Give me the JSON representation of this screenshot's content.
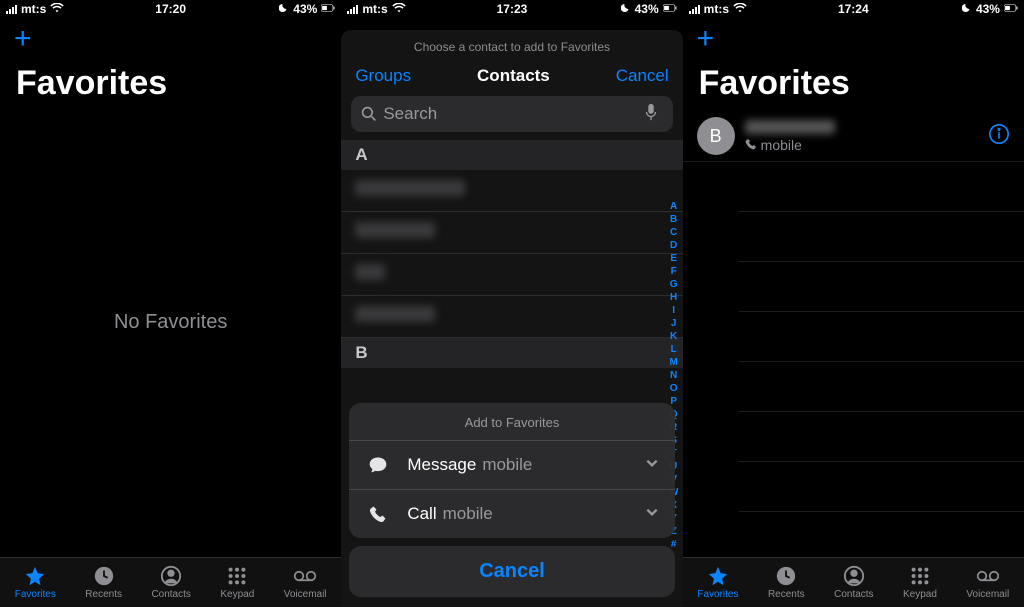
{
  "status": {
    "carrier": "mt:s",
    "battery": "43%",
    "times": [
      "17:20",
      "17:23",
      "17:24"
    ]
  },
  "screen1": {
    "title": "Favorites",
    "empty": "No Favorites"
  },
  "screen2": {
    "hint": "Choose a contact to add to Favorites",
    "groups": "Groups",
    "contacts_title": "Contacts",
    "cancel": "Cancel",
    "search_placeholder": "Search",
    "sections": [
      {
        "letter": "A",
        "rows": [
          110,
          80,
          30,
          80
        ]
      },
      {
        "letter": "B",
        "rows": []
      }
    ],
    "index_letters": [
      "A",
      "B",
      "C",
      "D",
      "E",
      "F",
      "G",
      "H",
      "I",
      "J",
      "K",
      "L",
      "M",
      "N",
      "O",
      "P",
      "Q",
      "R",
      "S",
      "T",
      "U",
      "V",
      "W",
      "X",
      "Y",
      "Z",
      "#"
    ],
    "sheet": {
      "title": "Add to Favorites",
      "rows": [
        {
          "icon": "message",
          "label": "Message",
          "meta": "mobile"
        },
        {
          "icon": "call",
          "label": "Call",
          "meta": "mobile"
        }
      ],
      "cancel": "Cancel"
    }
  },
  "screen3": {
    "title": "Favorites",
    "fav": {
      "initial": "B",
      "sub": "mobile"
    }
  },
  "tabs": {
    "favorites": "Favorites",
    "recents": "Recents",
    "contacts": "Contacts",
    "keypad": "Keypad",
    "voicemail": "Voicemail"
  }
}
